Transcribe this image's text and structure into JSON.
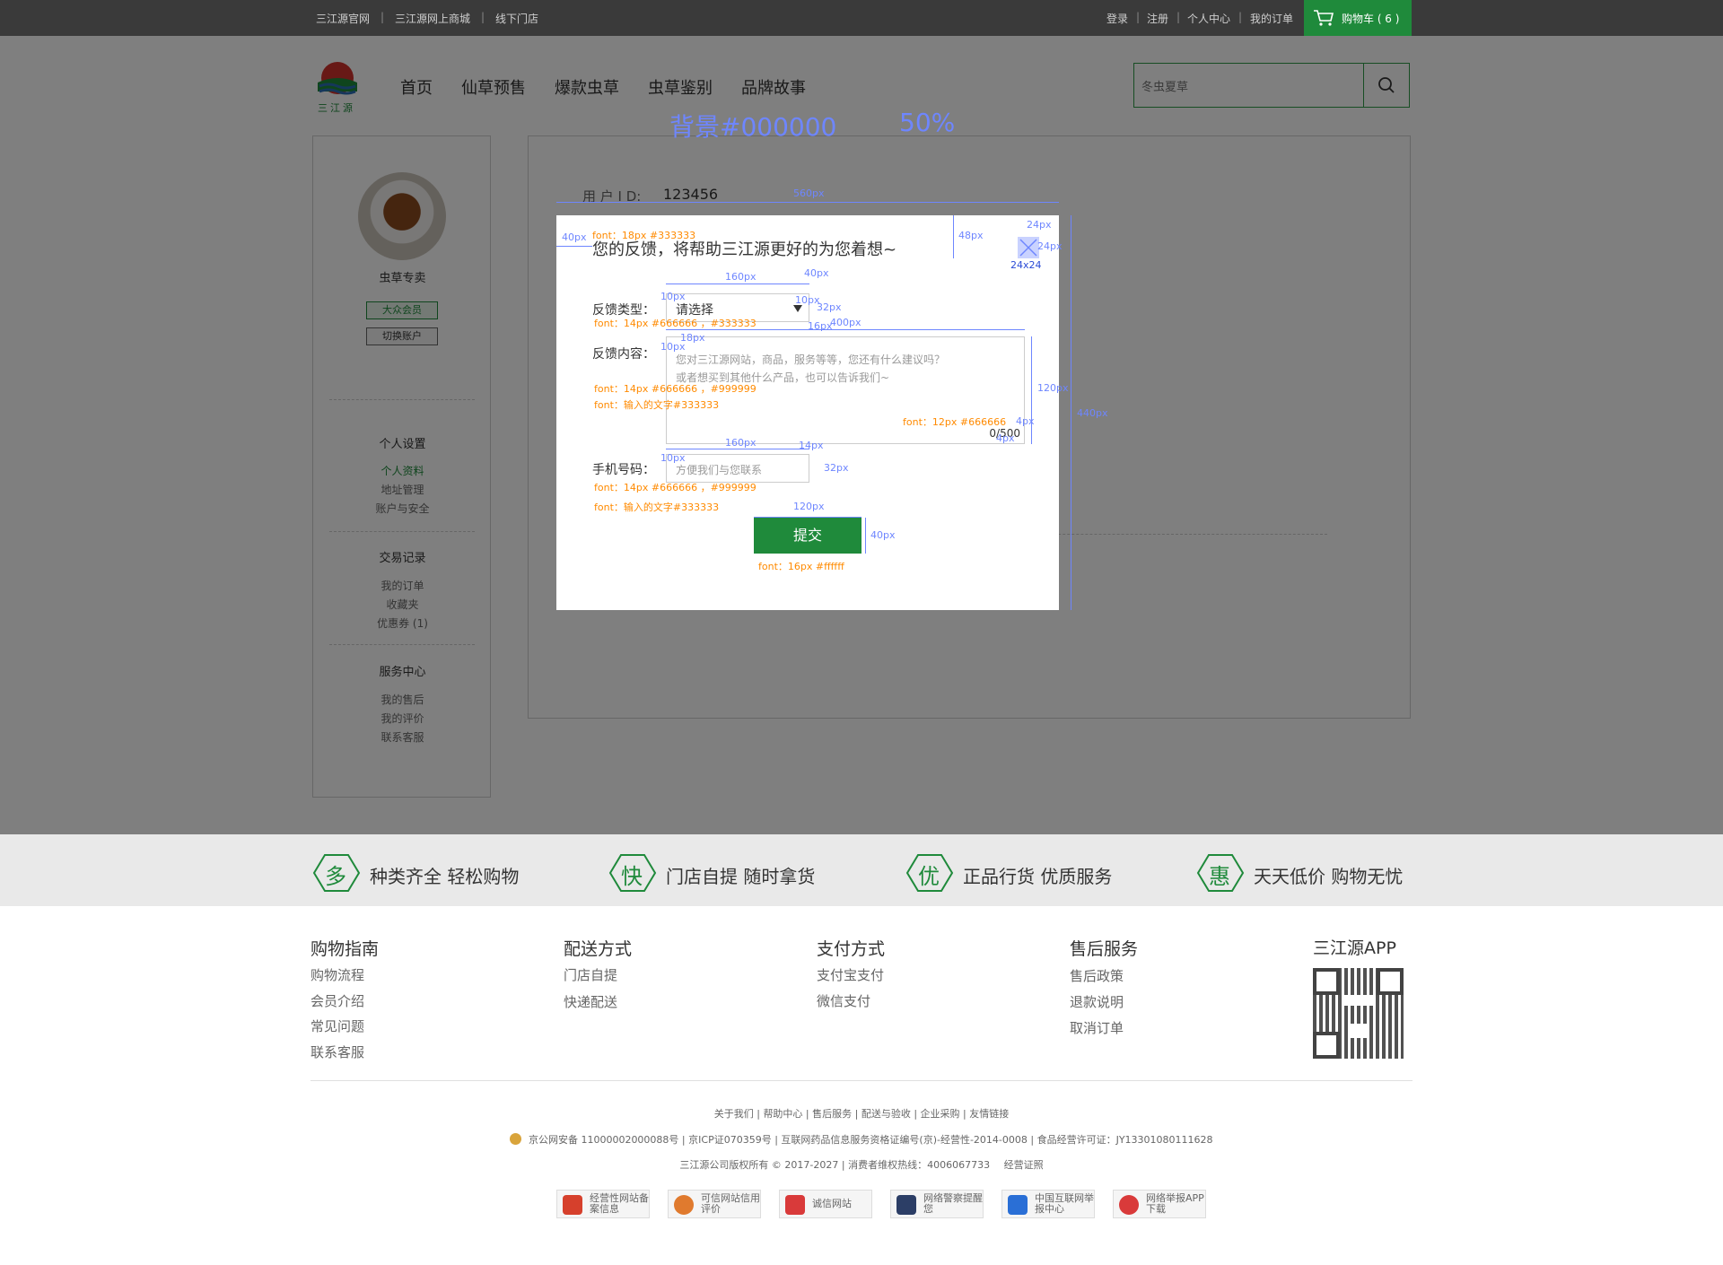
{
  "topbar": {
    "left_links": [
      "三江源官网",
      "三江源网上商城",
      "线下门店"
    ],
    "right_links": [
      "登录",
      "注册",
      "个人中心",
      "我的订单"
    ],
    "cart_label": "购物车 ( 6 )"
  },
  "header": {
    "logo_text": "三江源",
    "nav": [
      "首页",
      "仙草预售",
      "爆款虫草",
      "虫草鉴别",
      "品牌故事"
    ],
    "search_placeholder": "冬虫夏草"
  },
  "sidebar": {
    "username": "虫草专卖",
    "member_badge": "大众会员",
    "switch_account": "切换账户",
    "sections": [
      {
        "title": "个人设置",
        "items": [
          "个人资料",
          "地址管理",
          "账户与安全"
        ]
      },
      {
        "title": "交易记录",
        "items": [
          "我的订单",
          "收藏夹",
          "优惠券 (1)"
        ]
      },
      {
        "title": "服务中心",
        "items": [
          "我的售后",
          "我的评价",
          "联系客服"
        ]
      }
    ]
  },
  "content": {
    "user_id_label": "用 户 I D:",
    "user_id_value": "123456"
  },
  "overlay": {
    "note_bg": "背景#000000",
    "note_opacity": "50%"
  },
  "modal": {
    "title": "您的反馈，将帮助三江源更好的为您着想~",
    "type_label": "反馈类型：",
    "type_select": "请选择",
    "content_label": "反馈内容：",
    "content_placeholder_1": "您对三江源网站，商品，服务等等，您还有什么建议吗？",
    "content_placeholder_2": "或者想买到其他什么产品，也可以告诉我们~",
    "char_count": "0/500",
    "phone_label": "手机号码：",
    "phone_placeholder": "方便我们与您联系",
    "submit": "提交"
  },
  "annotations": {
    "title_font": "font：18px  #333333",
    "type_font": "font：14px  #666666  ，#333333",
    "content_font": "font：14px  #666666  ，#999999",
    "content_input": "font：输入的文字#333333",
    "count_font": "font：12px  #666666",
    "phone_font": "font：14px  #666666  ，#999999",
    "phone_input": "font：输入的文字#333333",
    "submit_font": "font：16px  #ffffff",
    "close_size": "24x24",
    "dims": [
      "560px",
      "40px",
      "48px",
      "24px",
      "24px",
      "160px",
      "40px",
      "10px",
      "10px",
      "32px",
      "16px",
      "400px",
      "18px",
      "10px",
      "120px",
      "4px",
      "4px",
      "160px",
      "14px",
      "10px",
      "32px",
      "120px",
      "40px",
      "440px"
    ]
  },
  "features": [
    {
      "char": "多",
      "text": "种类齐全 轻松购物"
    },
    {
      "char": "快",
      "text": "门店自提   随时拿货"
    },
    {
      "char": "优",
      "text": "正品行货   优质服务"
    },
    {
      "char": "惠",
      "text": "天天低价   购物无忧"
    }
  ],
  "footer": {
    "columns": [
      {
        "title": "购物指南",
        "items": [
          "购物流程",
          "会员介绍",
          "常见问题",
          "联系客服"
        ]
      },
      {
        "title": "配送方式",
        "items": [
          "门店自提",
          "快递配送"
        ]
      },
      {
        "title": "支付方式",
        "items": [
          "支付宝支付",
          "微信支付"
        ]
      },
      {
        "title": "售后服务",
        "items": [
          "售后政策",
          "退款说明",
          "取消订单"
        ]
      }
    ],
    "app_title": "三江源APP",
    "links": [
      "关于我们",
      "帮助中心",
      "售后服务",
      "配送与验收",
      "企业采购",
      "友情链接"
    ],
    "license_line": [
      "京公网安备 11000002000088号",
      "京ICP证070359号",
      "互联网药品信息服务资格证编号(京)-经营性-2014-0008",
      "食品经营许可证：JY13301080111628"
    ],
    "copyright_line": [
      "三江源公司版权所有 © 2017-2027",
      "消费者维权热线：4006067733",
      "经营证照"
    ],
    "badges": [
      "经营性网站备案信息",
      "可信网站信用评价",
      "诚信网站",
      "网络警察提醒您",
      "中国互联网举报中心",
      "网络举报APP下载"
    ]
  },
  "colors": {
    "green": "#1f8a3b",
    "annotation_orange": "#ff8a00",
    "annotation_blue": "#6e86ff",
    "overlay": "#000000"
  }
}
